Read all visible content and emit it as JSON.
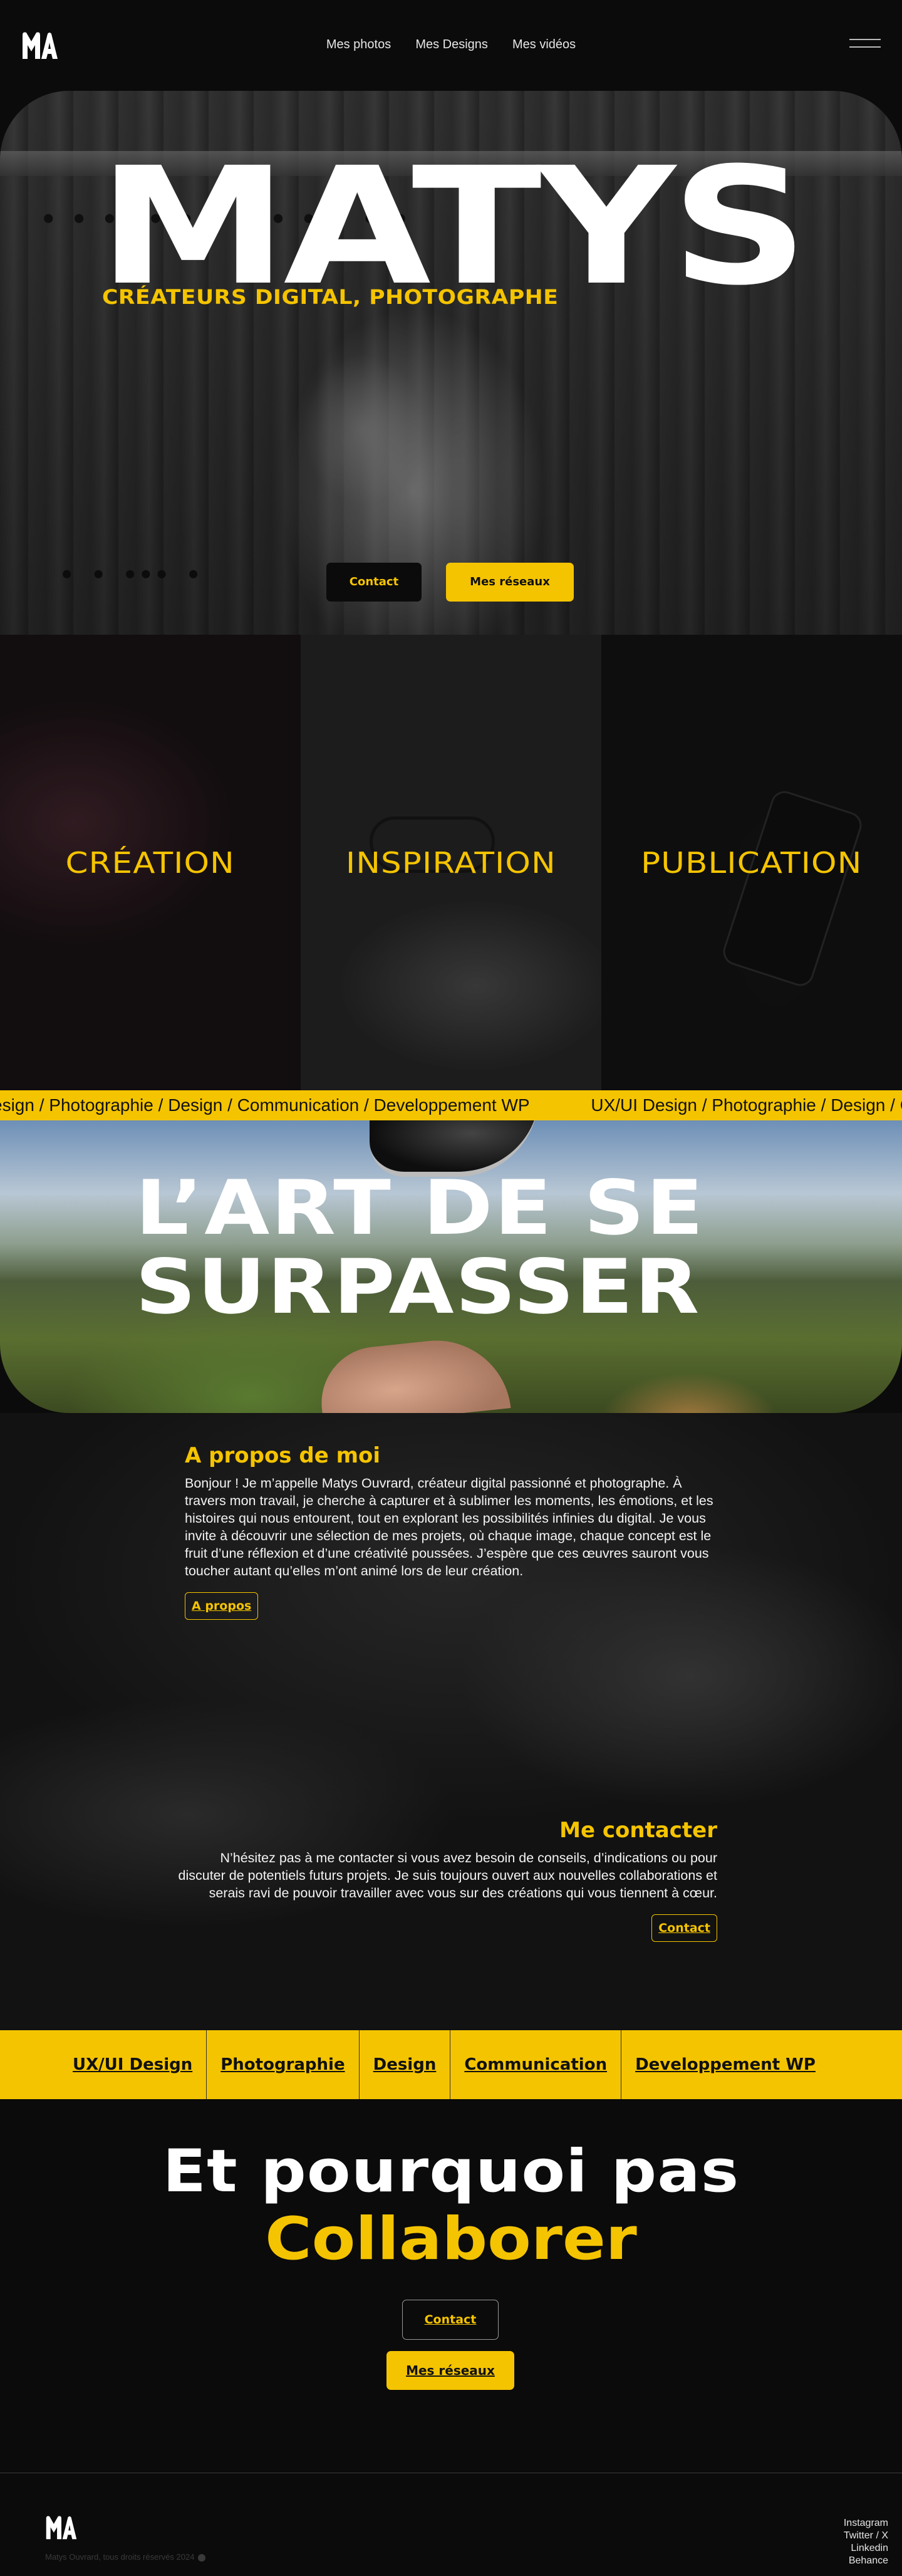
{
  "header": {
    "logo_text": "MA",
    "nav": [
      "Mes photos",
      "Mes Designs",
      "Mes vidéos"
    ]
  },
  "hero": {
    "title": "MATYS",
    "subtitle": "CRÉATEURS DIGITAL, PHOTOGRAPHE",
    "contact_label": "Contact",
    "social_label": "Mes réseaux"
  },
  "panels": [
    "CRÉATION",
    "INSPIRATION",
    "PUBLICATION"
  ],
  "marquee": {
    "items": [
      "esign / Photographie / Design / Communication / Developpement WP",
      "UX/UI Design / Photographie / Design / Communication / Developpement WP"
    ]
  },
  "art": {
    "line1": "L’ART DE SE",
    "line2": "SURPASSER"
  },
  "about": {
    "title": "A propos de moi",
    "text": "Bonjour ! Je m’appelle Matys Ouvrard, créateur digital passionné et photographe. À travers mon travail, je cherche à capturer et à sublimer les moments, les émotions, et les histoires qui nous entourent, tout en explorant les possibilités infinies du digital. Je vous invite à découvrir une sélection de mes projets, où chaque image, chaque concept est le fruit d’une réflexion et d’une créativité poussées. J’espère que ces œuvres sauront vous toucher autant qu’elles m’ont animé lors de leur création.",
    "button": "A propos"
  },
  "contact": {
    "title": "Me contacter",
    "text": "N’hésitez pas à me contacter si vous avez besoin de conseils, d’indications ou pour discuter de potentiels futurs projets. Je suis toujours ouvert aux nouvelles collaborations et serais ravi de pouvoir travailler avec vous sur des créations qui vous tiennent à cœur.",
    "button": "Contact"
  },
  "skills": [
    "UX/UI Design",
    "Photographie",
    "Design",
    "Communication",
    "Developpement WP"
  ],
  "collab": {
    "line1": "Et pourquoi pas",
    "line2": "Collaborer",
    "contact_label": "Contact",
    "social_label": "Mes réseaux"
  },
  "footer": {
    "copyright": "Matys Ouvrard, tous droits réservés 2024",
    "socials": [
      "Instagram",
      "Twitter / X",
      "Linkedin",
      "Behance"
    ]
  },
  "colors": {
    "accent": "#f5c400",
    "background": "#0b0b0b"
  }
}
